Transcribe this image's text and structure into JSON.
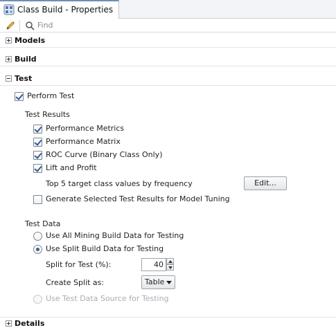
{
  "tab": {
    "title": "Class Build - Properties",
    "icon": "class-build-icon"
  },
  "toolbar": {
    "edit_icon": "pencil-icon",
    "search_icon": "search-icon",
    "search_placeholder": "Find",
    "search_value": ""
  },
  "sections": {
    "models": {
      "label": "Models",
      "expanded": false
    },
    "build": {
      "label": "Build",
      "expanded": false
    },
    "test": {
      "label": "Test",
      "expanded": true
    },
    "details": {
      "label": "Details",
      "expanded": false
    }
  },
  "test": {
    "perform_test": {
      "label": "Perform Test",
      "checked": true
    },
    "results_heading": "Test Results",
    "results": [
      {
        "label": "Performance Metrics",
        "checked": true
      },
      {
        "label": "Performance Matrix",
        "checked": true
      },
      {
        "label": "ROC Curve (Binary Class Only)",
        "checked": true
      },
      {
        "label": "Lift and Profit",
        "checked": true
      }
    ],
    "top_target_label": "Top 5 target class values by frequency",
    "edit_button_label": "Edit...",
    "generate_tuning": {
      "label": "Generate Selected Test Results for Model Tuning",
      "checked": false
    },
    "data_heading": "Test Data",
    "data_options": [
      {
        "label": "Use All Mining Build Data for Testing",
        "selected": false,
        "enabled": true
      },
      {
        "label": "Use Split Build Data for Testing",
        "selected": true,
        "enabled": true
      },
      {
        "label": "Use Test Data Source for Testing",
        "selected": false,
        "enabled": false
      }
    ],
    "split_label": "Split for Test (%):",
    "split_value": "40",
    "create_split_label": "Create Split as:",
    "create_split_value": "Table"
  },
  "colors": {
    "tab_accent": "#6f8fb3",
    "check_color": "#2f5d93"
  }
}
